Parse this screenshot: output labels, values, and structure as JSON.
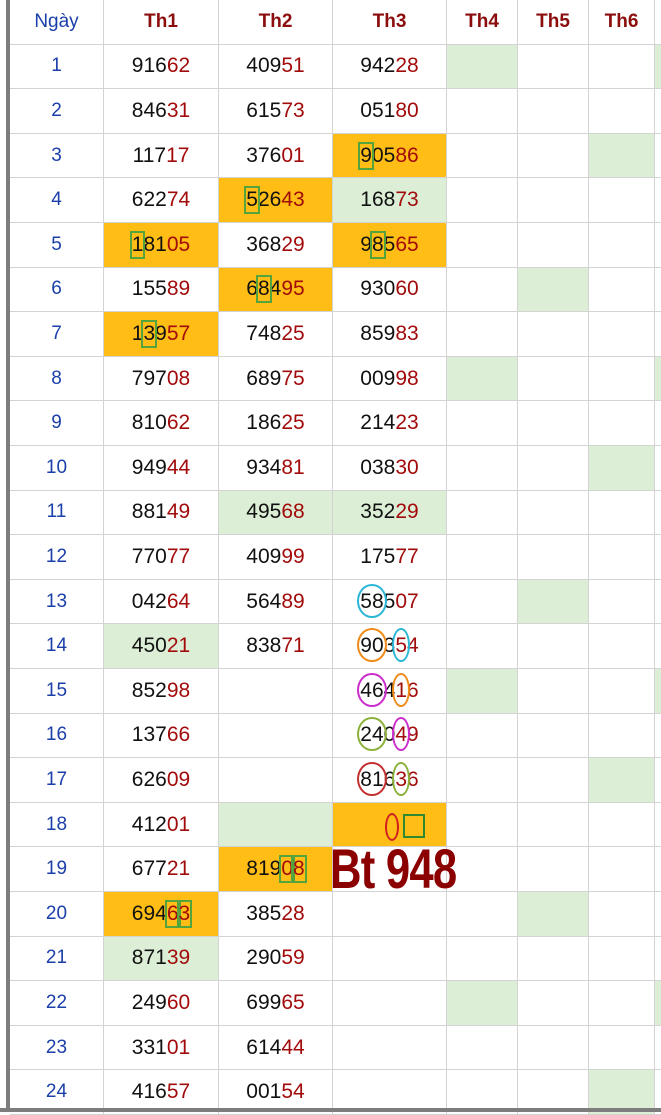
{
  "headers": {
    "day": "Ngày",
    "columns": [
      "Th1",
      "Th2",
      "Th3",
      "Th4",
      "Th5",
      "Th6"
    ]
  },
  "annotation": "Bt 948",
  "rows": [
    {
      "day": "1",
      "cells": [
        {
          "head": "916",
          "tail": "62"
        },
        {
          "head": "409",
          "tail": "51"
        },
        {
          "head": "942",
          "tail": "28"
        },
        {
          "bg": "green"
        },
        {},
        {},
        {
          "bg": "green"
        }
      ]
    },
    {
      "day": "2",
      "cells": [
        {
          "head": "846",
          "tail": "31"
        },
        {
          "head": "615",
          "tail": "73"
        },
        {
          "head": "051",
          "tail": "80"
        },
        {},
        {},
        {},
        {}
      ]
    },
    {
      "day": "3",
      "cells": [
        {
          "head": "117",
          "tail": "17"
        },
        {
          "head": "376",
          "tail": "01"
        },
        {
          "head": "905",
          "tail": "86",
          "bg": "orange",
          "box": [
            0
          ]
        },
        {},
        {},
        {
          "bg": "green"
        },
        {}
      ]
    },
    {
      "day": "4",
      "cells": [
        {
          "head": "622",
          "tail": "74"
        },
        {
          "head": "526",
          "tail": "43",
          "bg": "orange",
          "box": [
            0
          ]
        },
        {
          "head": "168",
          "tail": "73",
          "bg": "green"
        },
        {},
        {},
        {},
        {}
      ]
    },
    {
      "day": "5",
      "cells": [
        {
          "head": "181",
          "tail": "05",
          "bg": "orange",
          "box": [
            0
          ]
        },
        {
          "head": "368",
          "tail": "29"
        },
        {
          "head": "985",
          "tail": "65",
          "bg": "orange",
          "box": [
            1
          ]
        },
        {},
        {},
        {},
        {}
      ]
    },
    {
      "day": "6",
      "cells": [
        {
          "head": "155",
          "tail": "89"
        },
        {
          "head": "684",
          "tail": "95",
          "bg": "orange",
          "box": [
            1
          ]
        },
        {
          "head": "930",
          "tail": "60"
        },
        {},
        {
          "bg": "green"
        },
        {},
        {}
      ]
    },
    {
      "day": "7",
      "cells": [
        {
          "head": "139",
          "tail": "57",
          "bg": "orange",
          "box": [
            1
          ]
        },
        {
          "head": "748",
          "tail": "25"
        },
        {
          "head": "859",
          "tail": "83"
        },
        {},
        {},
        {},
        {}
      ]
    },
    {
      "day": "8",
      "cells": [
        {
          "head": "797",
          "tail": "08"
        },
        {
          "head": "689",
          "tail": "75"
        },
        {
          "head": "009",
          "tail": "98"
        },
        {
          "bg": "green"
        },
        {},
        {},
        {
          "bg": "green"
        }
      ]
    },
    {
      "day": "9",
      "cells": [
        {
          "head": "810",
          "tail": "62"
        },
        {
          "head": "186",
          "tail": "25"
        },
        {
          "head": "214",
          "tail": "23"
        },
        {},
        {},
        {},
        {}
      ]
    },
    {
      "day": "10",
      "cells": [
        {
          "head": "949",
          "tail": "44"
        },
        {
          "head": "934",
          "tail": "81"
        },
        {
          "head": "038",
          "tail": "30"
        },
        {},
        {},
        {
          "bg": "green"
        },
        {}
      ]
    },
    {
      "day": "11",
      "cells": [
        {
          "head": "881",
          "tail": "49"
        },
        {
          "head": "495",
          "tail": "68",
          "bg": "green"
        },
        {
          "head": "352",
          "tail": "29",
          "bg": "green"
        },
        {},
        {},
        {},
        {}
      ]
    },
    {
      "day": "12",
      "cells": [
        {
          "head": "770",
          "tail": "77"
        },
        {
          "head": "409",
          "tail": "99"
        },
        {
          "head": "175",
          "tail": "77"
        },
        {},
        {},
        {},
        {}
      ]
    },
    {
      "day": "13",
      "cells": [
        {
          "head": "042",
          "tail": "64"
        },
        {
          "head": "564",
          "tail": "89"
        },
        {
          "head": "585",
          "tail": "07",
          "rings": [
            {
              "c": "#2bb6d6",
              "from": 0,
              "to": 2
            }
          ]
        },
        {},
        {
          "bg": "green"
        },
        {},
        {}
      ]
    },
    {
      "day": "14",
      "cells": [
        {
          "head": "450",
          "tail": "21",
          "bg": "green"
        },
        {
          "head": "838",
          "tail": "71"
        },
        {
          "head": "903",
          "tail": "54",
          "rings": [
            {
              "c": "#f08a18",
              "from": 0,
              "to": 2
            },
            {
              "c": "#2bb6d6",
              "from": 3,
              "to": 1
            }
          ]
        },
        {},
        {},
        {},
        {}
      ]
    },
    {
      "day": "15",
      "cells": [
        {
          "head": "852",
          "tail": "98"
        },
        {},
        {
          "head": "464",
          "tail": "16",
          "rings": [
            {
              "c": "#cc2ccc",
              "from": 0,
              "to": 2
            },
            {
              "c": "#f08a18",
              "from": 3,
              "to": 1
            }
          ]
        },
        {
          "bg": "green"
        },
        {},
        {},
        {
          "bg": "green"
        }
      ]
    },
    {
      "day": "16",
      "cells": [
        {
          "head": "137",
          "tail": "66"
        },
        {},
        {
          "head": "240",
          "tail": "49",
          "rings": [
            {
              "c": "#8bb13a",
              "from": 0,
              "to": 2
            },
            {
              "c": "#cc2ccc",
              "from": 3,
              "to": 1
            }
          ]
        },
        {},
        {},
        {},
        {}
      ]
    },
    {
      "day": "17",
      "cells": [
        {
          "head": "626",
          "tail": "09"
        },
        {},
        {
          "head": "816",
          "tail": "36",
          "rings": [
            {
              "c": "#c43030",
              "from": 0,
              "to": 2
            },
            {
              "c": "#8bb13a",
              "from": 3,
              "to": 1
            }
          ]
        },
        {},
        {},
        {
          "bg": "green"
        },
        {}
      ]
    },
    {
      "day": "18",
      "cells": [
        {
          "head": "412",
          "tail": "01"
        },
        {
          "bg": "green"
        },
        {
          "bg": "orange",
          "marks": true
        },
        {},
        {},
        {},
        {}
      ]
    },
    {
      "day": "19",
      "cells": [
        {
          "head": "677",
          "tail": "21"
        },
        {
          "head": "819",
          "tail": "08",
          "bg": "orange",
          "box": [
            3,
            4
          ]
        },
        {},
        {},
        {},
        {},
        {}
      ]
    },
    {
      "day": "20",
      "cells": [
        {
          "head": "694",
          "tail": "63",
          "bg": "orange",
          "box": [
            3,
            4
          ]
        },
        {
          "head": "385",
          "tail": "28"
        },
        {},
        {},
        {
          "bg": "green"
        },
        {},
        {}
      ]
    },
    {
      "day": "21",
      "cells": [
        {
          "head": "871",
          "tail": "39",
          "bg": "green"
        },
        {
          "head": "290",
          "tail": "59"
        },
        {},
        {},
        {},
        {},
        {}
      ]
    },
    {
      "day": "22",
      "cells": [
        {
          "head": "249",
          "tail": "60"
        },
        {
          "head": "699",
          "tail": "65"
        },
        {},
        {
          "bg": "green"
        },
        {},
        {},
        {
          "bg": "green"
        }
      ]
    },
    {
      "day": "23",
      "cells": [
        {
          "head": "331",
          "tail": "01"
        },
        {
          "head": "614",
          "tail": "44"
        },
        {},
        {},
        {},
        {},
        {}
      ]
    },
    {
      "day": "24",
      "cells": [
        {
          "head": "416",
          "tail": "57"
        },
        {
          "head": "001",
          "tail": "54"
        },
        {},
        {},
        {},
        {
          "bg": "green"
        },
        {}
      ]
    }
  ]
}
